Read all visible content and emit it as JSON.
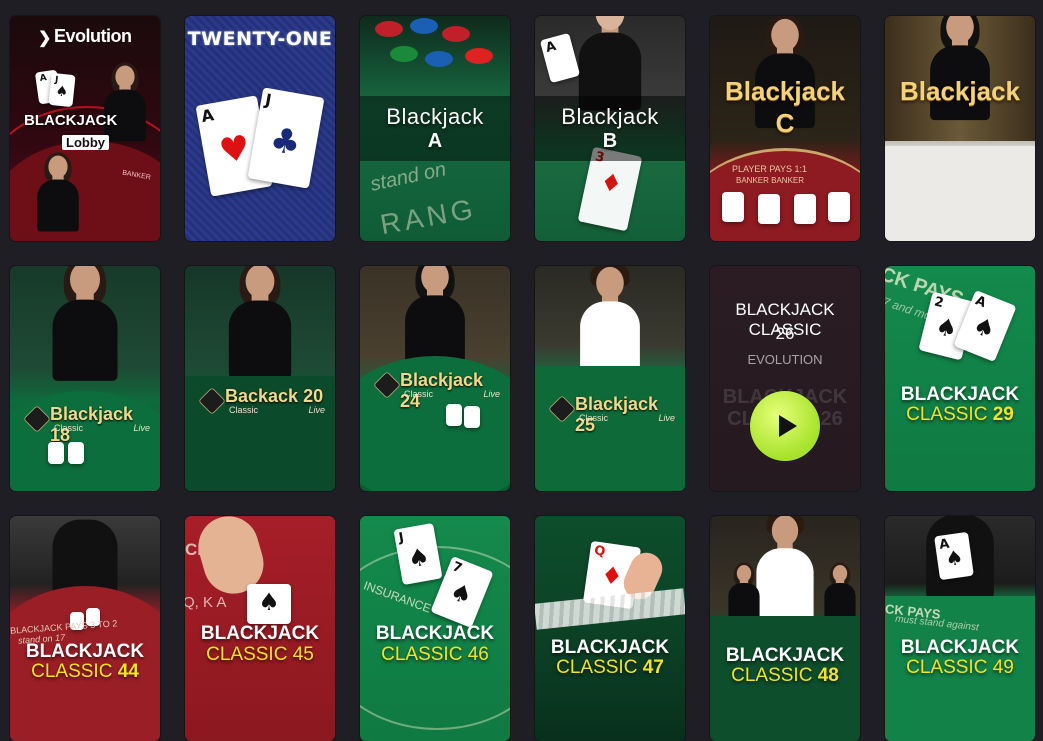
{
  "tiles": [
    {
      "id": "t1",
      "evolution": "Evolution",
      "title": "BLACKJACK",
      "sub": "Lobby",
      "banker": "BANKER"
    },
    {
      "id": "t2",
      "title": "TWENTY-ONE",
      "card1": "A",
      "card2": "J"
    },
    {
      "id": "t3",
      "title": "Blackjack",
      "letter": "A",
      "felt_text": "stand on",
      "felt_text2": "RANG"
    },
    {
      "id": "t4",
      "title": "Blackjack",
      "letter": "B"
    },
    {
      "id": "t5",
      "title": "Blackjack",
      "letter": "C",
      "felt_text": "PLAYER PAYS 1:1",
      "felt_text2": "BANKER BANKER"
    },
    {
      "id": "t6",
      "title": "Blackjack"
    },
    {
      "id": "t7",
      "name": "Blackjack 18",
      "sub": "Classic",
      "live": "Live"
    },
    {
      "id": "t8",
      "name": "Backack 20",
      "sub": "Classic",
      "live": "Live"
    },
    {
      "id": "t9",
      "name": "Blackjack 24",
      "sub": "Classic",
      "live": "Live"
    },
    {
      "id": "t10",
      "name": "Blackjack 25",
      "sub": "Classic",
      "live": "Live"
    },
    {
      "id": "t11",
      "title": "BLACKJACK CLASSIC",
      "number": "26",
      "provider": "EVOLUTION",
      "ghost1": "BLACKJACK",
      "ghost2": "CLASSIC 26"
    },
    {
      "id": "t12",
      "line1": "BLACKJACK",
      "line2a": "CLASSIC",
      "line2b": "29",
      "felt_text": "CK PAYS",
      "felt_text2": "7 and more draw"
    },
    {
      "id": "t13",
      "line1": "BLACKJACK",
      "line2a": "CLASSIC",
      "line2b": "44",
      "felt_text": "BLACKJACK PAYS 3 TO 2",
      "felt_text2": "stand on 17"
    },
    {
      "id": "t14",
      "line1": "BLACKJACK",
      "line2a": "CLASSIC",
      "line2b": "45",
      "felt_text": "CK PAYS",
      "felt_text2": "Q, K    A"
    },
    {
      "id": "t15",
      "line1": "BLACKJACK",
      "line2a": "CLASSIC",
      "line2b": "46",
      "felt_text": "INSURANCE"
    },
    {
      "id": "t16",
      "line1": "BLACKJACK",
      "line2a": "CLASSIC",
      "line2b": "47"
    },
    {
      "id": "t17",
      "line1": "BLACKJACK",
      "line2a": "CLASSIC",
      "line2b": "48"
    },
    {
      "id": "t18",
      "line1": "BLACKJACK",
      "line2a": "CLASSIC",
      "line2b": "49",
      "felt_text": "CK PAYS",
      "felt_text2": "must stand against"
    }
  ],
  "colors": {
    "background": "#1e1e24",
    "play_button": "#a6e22a",
    "felt_green": "#12824a",
    "felt_red": "#8e1a22"
  },
  "icons": {
    "play": "play-icon",
    "logo": "evolution-logo-icon"
  }
}
